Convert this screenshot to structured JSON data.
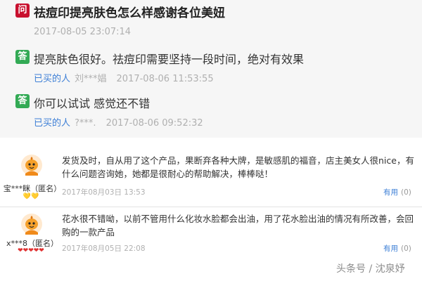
{
  "question": {
    "badge": "问",
    "title": "祛痘印提亮肤色怎么样感谢各位美妞",
    "time": "2017-08-05 23:07:14"
  },
  "answers": [
    {
      "badge": "答",
      "text": "提亮肤色很好。祛痘印需要坚持一段时间，绝对有效果",
      "buyer_label": "已买的人",
      "user": "刘***娼",
      "time": "2017-08-06 11:53:55"
    },
    {
      "badge": "答",
      "text": "你可以试试 感觉还不错",
      "buyer_label": "已买的人",
      "user": "?***.",
      "time": "2017-08-06 09:52:32"
    }
  ],
  "reviews": [
    {
      "user": "宝***眯（匿名）",
      "medals": "💛💛",
      "text": "发货及时，自从用了这个产品，果断弃各种大牌，是敏感肌的福音，店主美女人很nice，有什么问题咨询她，她都是很耐心的帮助解决，棒棒哒！",
      "date": "2017年08月03日 13:53",
      "useful_label": "有用",
      "useful_count": "(0)"
    },
    {
      "user": "x***8（匿名）",
      "medals": "❤❤❤❤❤",
      "text": "花水很不错呦，以前不管用什么化妆水脸都会出油，用了花水脸出油的情况有所改善，会回购的一款产品",
      "date": "2017年08月05日 22:08",
      "useful_label": "有用",
      "useful_count": "(0)"
    }
  ],
  "watermark": "头条号 / 沈泉妤",
  "icons": {
    "avatar": "orange-cartoon-avatar-icon"
  },
  "colors": {
    "question_badge": "#c8102e",
    "answer_badge": "#33aa55",
    "link_blue": "#3d7fd6",
    "muted_gray": "#b0b0b0",
    "qa_background": "#f6f6f6"
  }
}
